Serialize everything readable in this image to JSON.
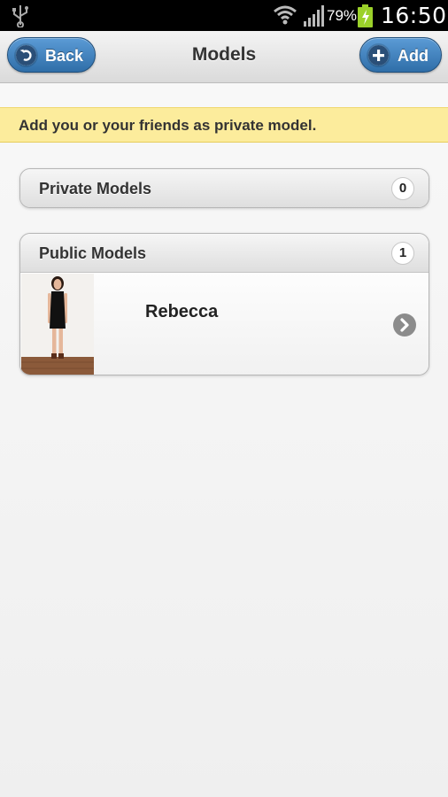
{
  "status_bar": {
    "battery_percent": "79%",
    "time": "16:50",
    "icons": [
      "usb-icon",
      "wifi-icon",
      "signal-icon",
      "battery-charging-icon"
    ]
  },
  "header": {
    "title": "Models",
    "back_label": "Back",
    "add_label": "Add"
  },
  "notice": {
    "text": "Add you or your friends as private model."
  },
  "groups": [
    {
      "title": "Private Models",
      "count": "0"
    },
    {
      "title": "Public Models",
      "count": "1",
      "items": [
        {
          "name": "Rebecca"
        }
      ]
    }
  ],
  "colors": {
    "button_blue": "#3d7fbf",
    "notice_yellow": "#fcec9c"
  }
}
